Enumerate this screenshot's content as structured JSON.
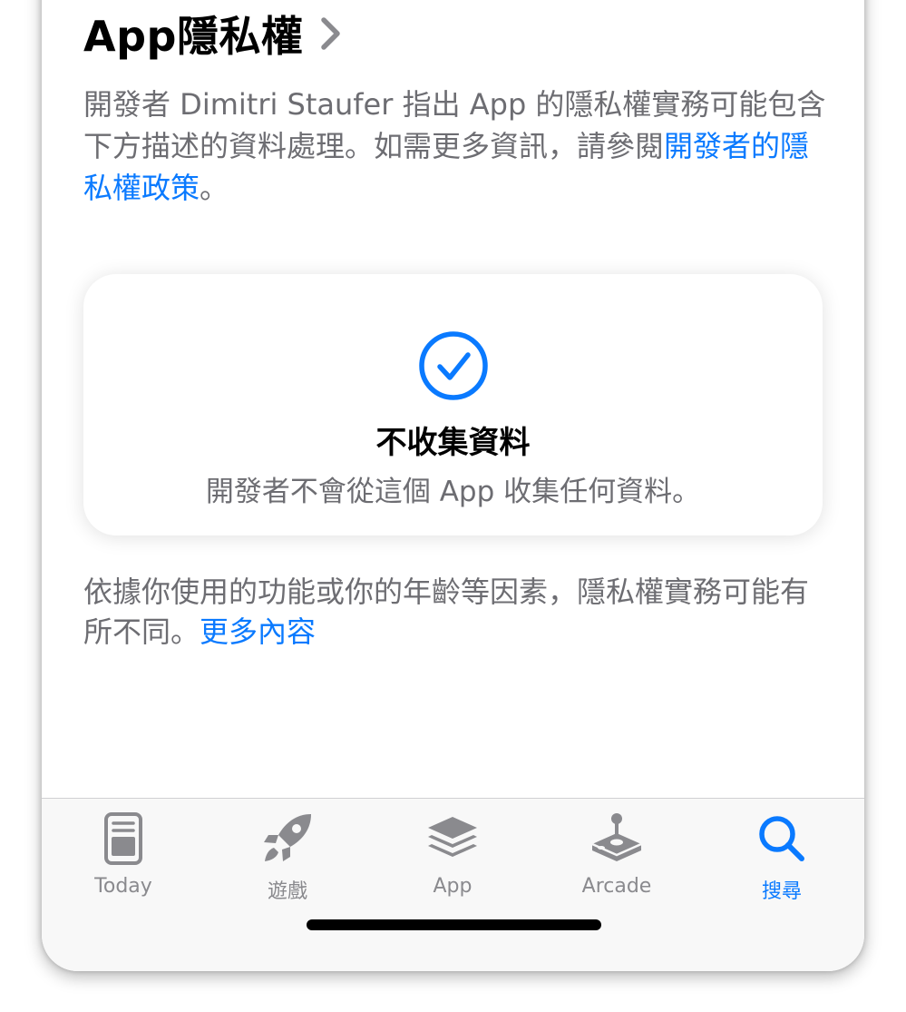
{
  "section": {
    "title": "App隱私權"
  },
  "description": {
    "text": "開發者 Dimitri Staufer 指出 App 的隱私權實務可能包含下方描述的資料處理。如需更多資訊，請參閱",
    "link": "開發者的隱私權政策",
    "end": "。"
  },
  "card": {
    "title": "不收集資料",
    "subtitle": "開發者不會從這個 App 收集任何資料。"
  },
  "note": {
    "text": "依據你使用的功能或你的年齡等因素，隱私權實務可能有所不同。",
    "link": "更多內容"
  },
  "tabs": [
    {
      "label": "Today",
      "icon": "today-icon"
    },
    {
      "label": "遊戲",
      "icon": "rocket-icon"
    },
    {
      "label": "App",
      "icon": "app-stack-icon"
    },
    {
      "label": "Arcade",
      "icon": "joystick-icon"
    },
    {
      "label": "搜尋",
      "icon": "search-icon",
      "active": true
    }
  ],
  "colors": {
    "accent": "#0a7aff",
    "secondary_text": "#6d6d72",
    "tab_inactive": "#8a8a8e"
  }
}
